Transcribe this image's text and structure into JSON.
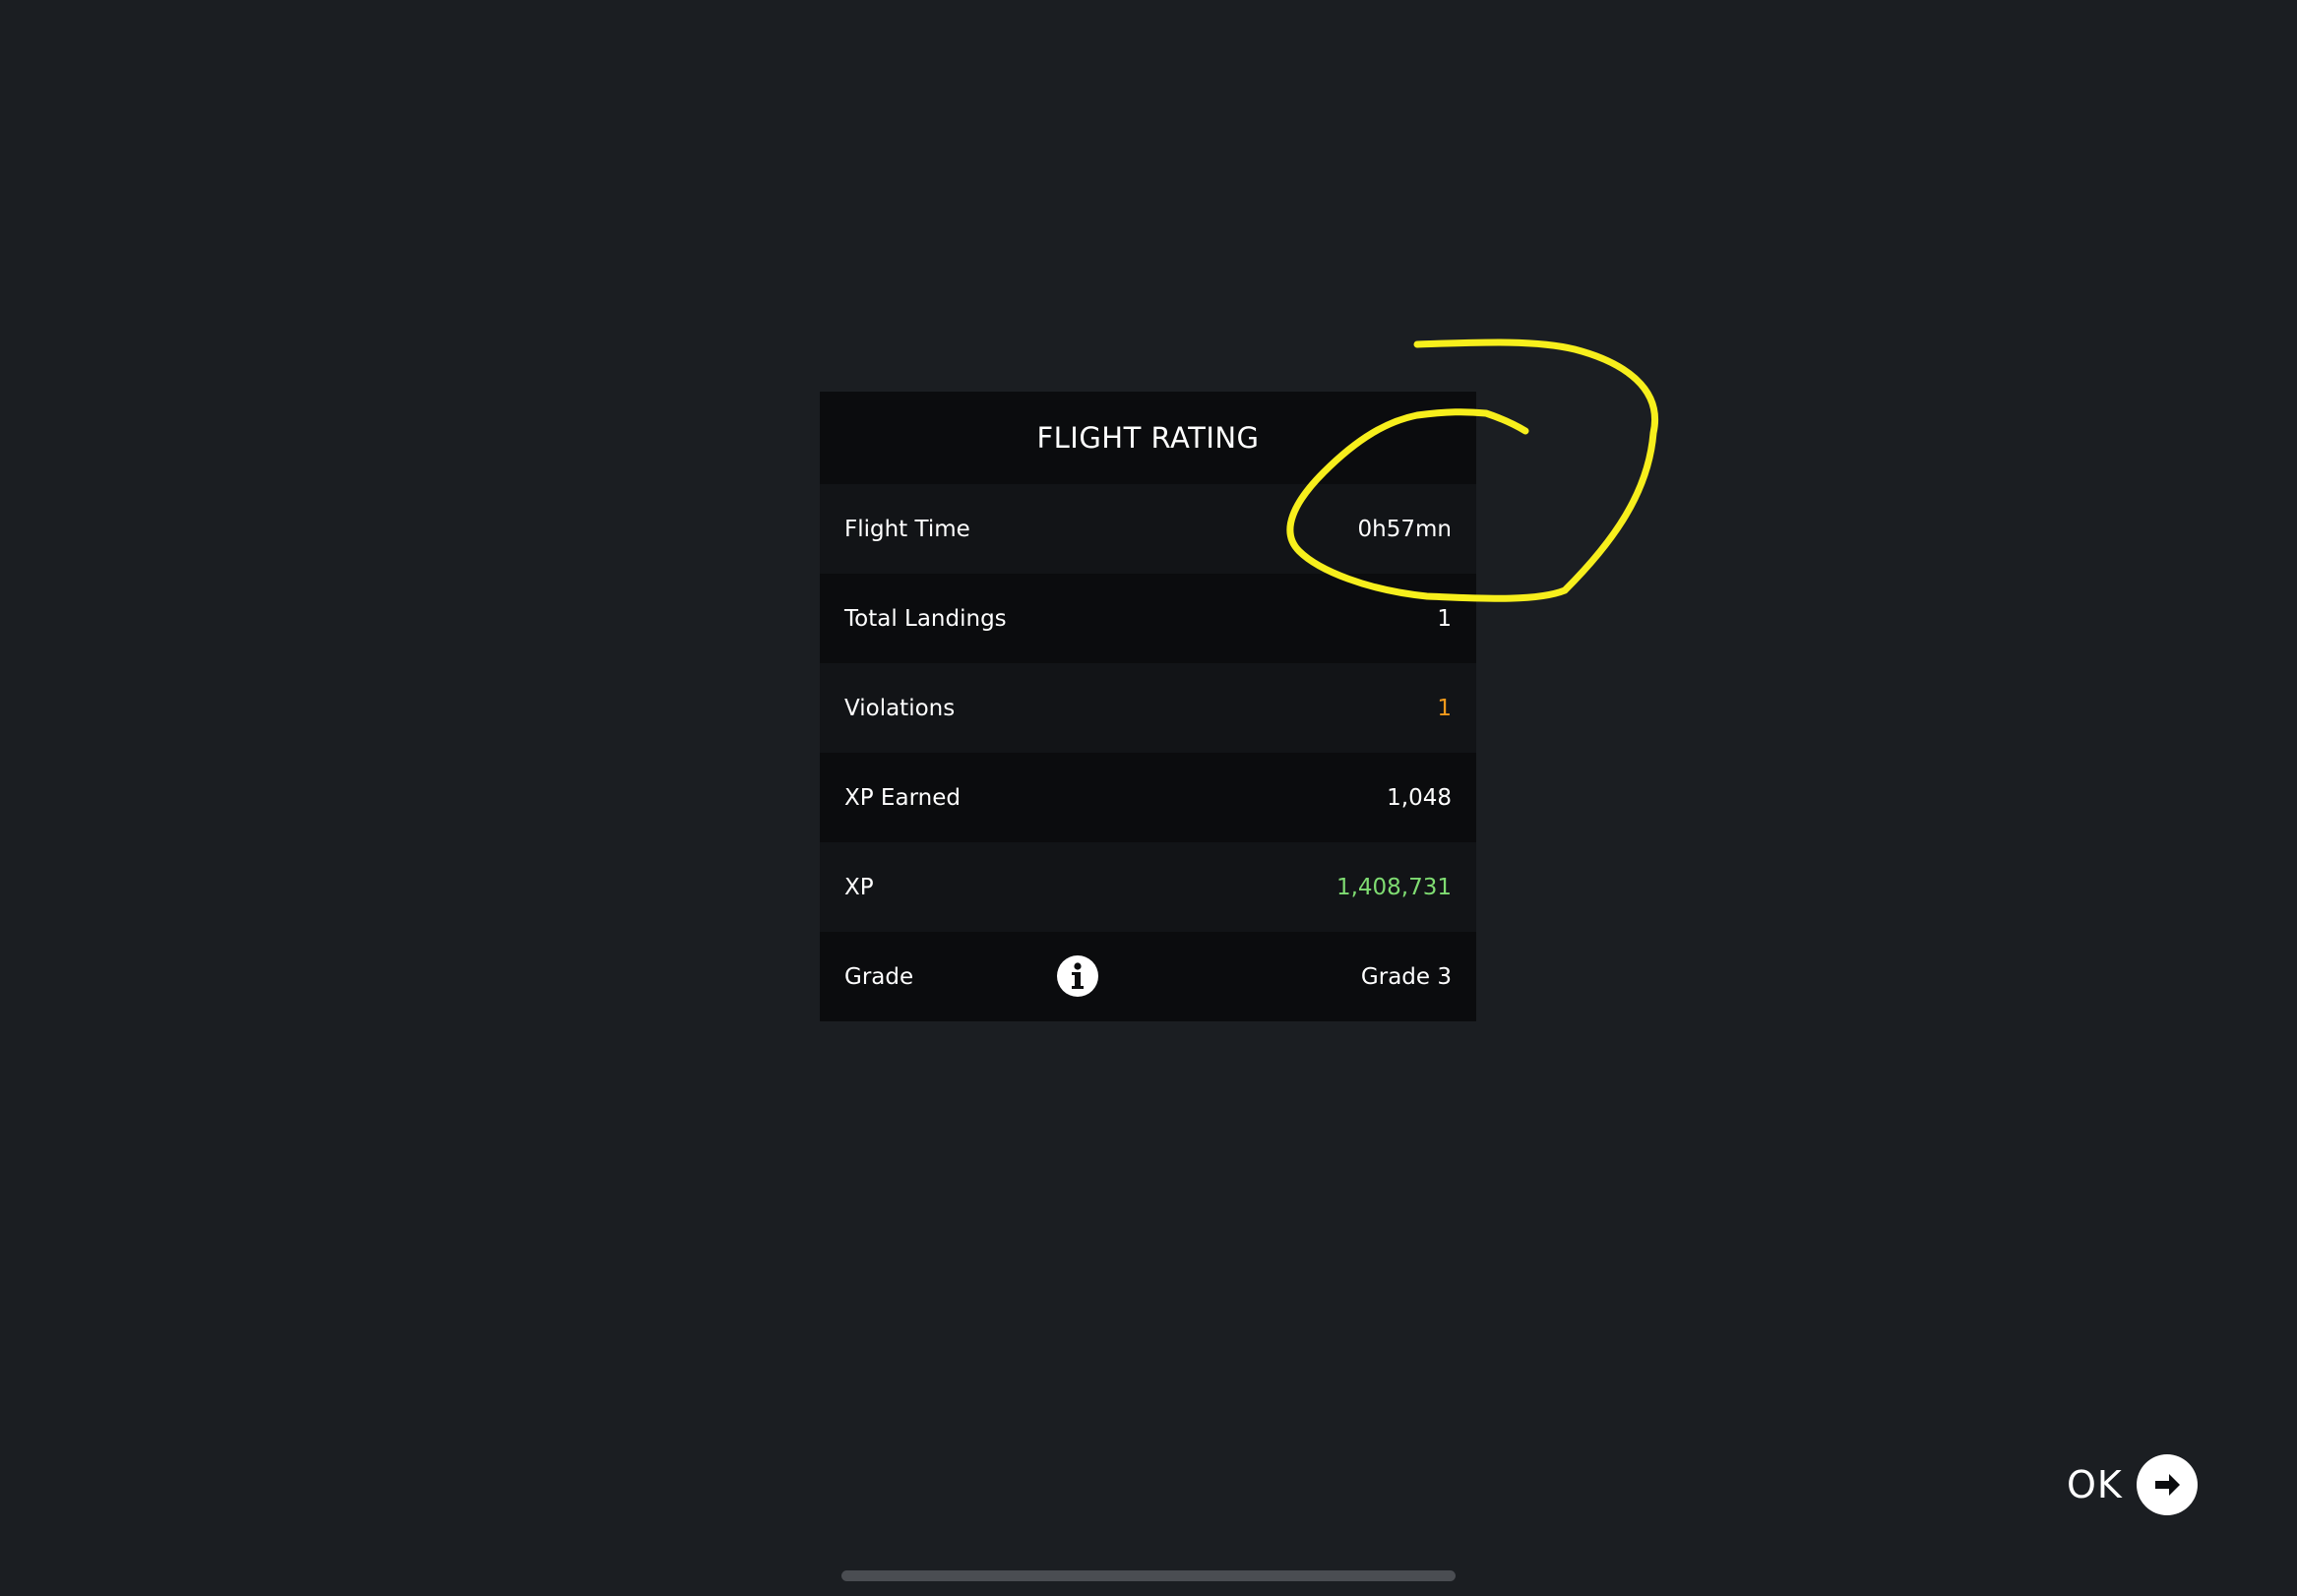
{
  "panel": {
    "title": "FLIGHT RATING",
    "rows": [
      {
        "label": "Flight Time",
        "value": "0h57mn"
      },
      {
        "label": "Total Landings",
        "value": "1"
      },
      {
        "label": "Violations",
        "value": "1"
      },
      {
        "label": "XP Earned",
        "value": "1,048"
      },
      {
        "label": "XP",
        "value": "1,408,731"
      },
      {
        "label": "Grade",
        "value": "Grade 3"
      }
    ]
  },
  "colors": {
    "violations": "#f29a1c",
    "xp_total": "#7fdc72",
    "annotation": "#f7ef1c"
  },
  "ok_button": {
    "label": "OK",
    "icon": "arrow-right-circle-icon"
  },
  "grade_info_icon": "info-icon"
}
